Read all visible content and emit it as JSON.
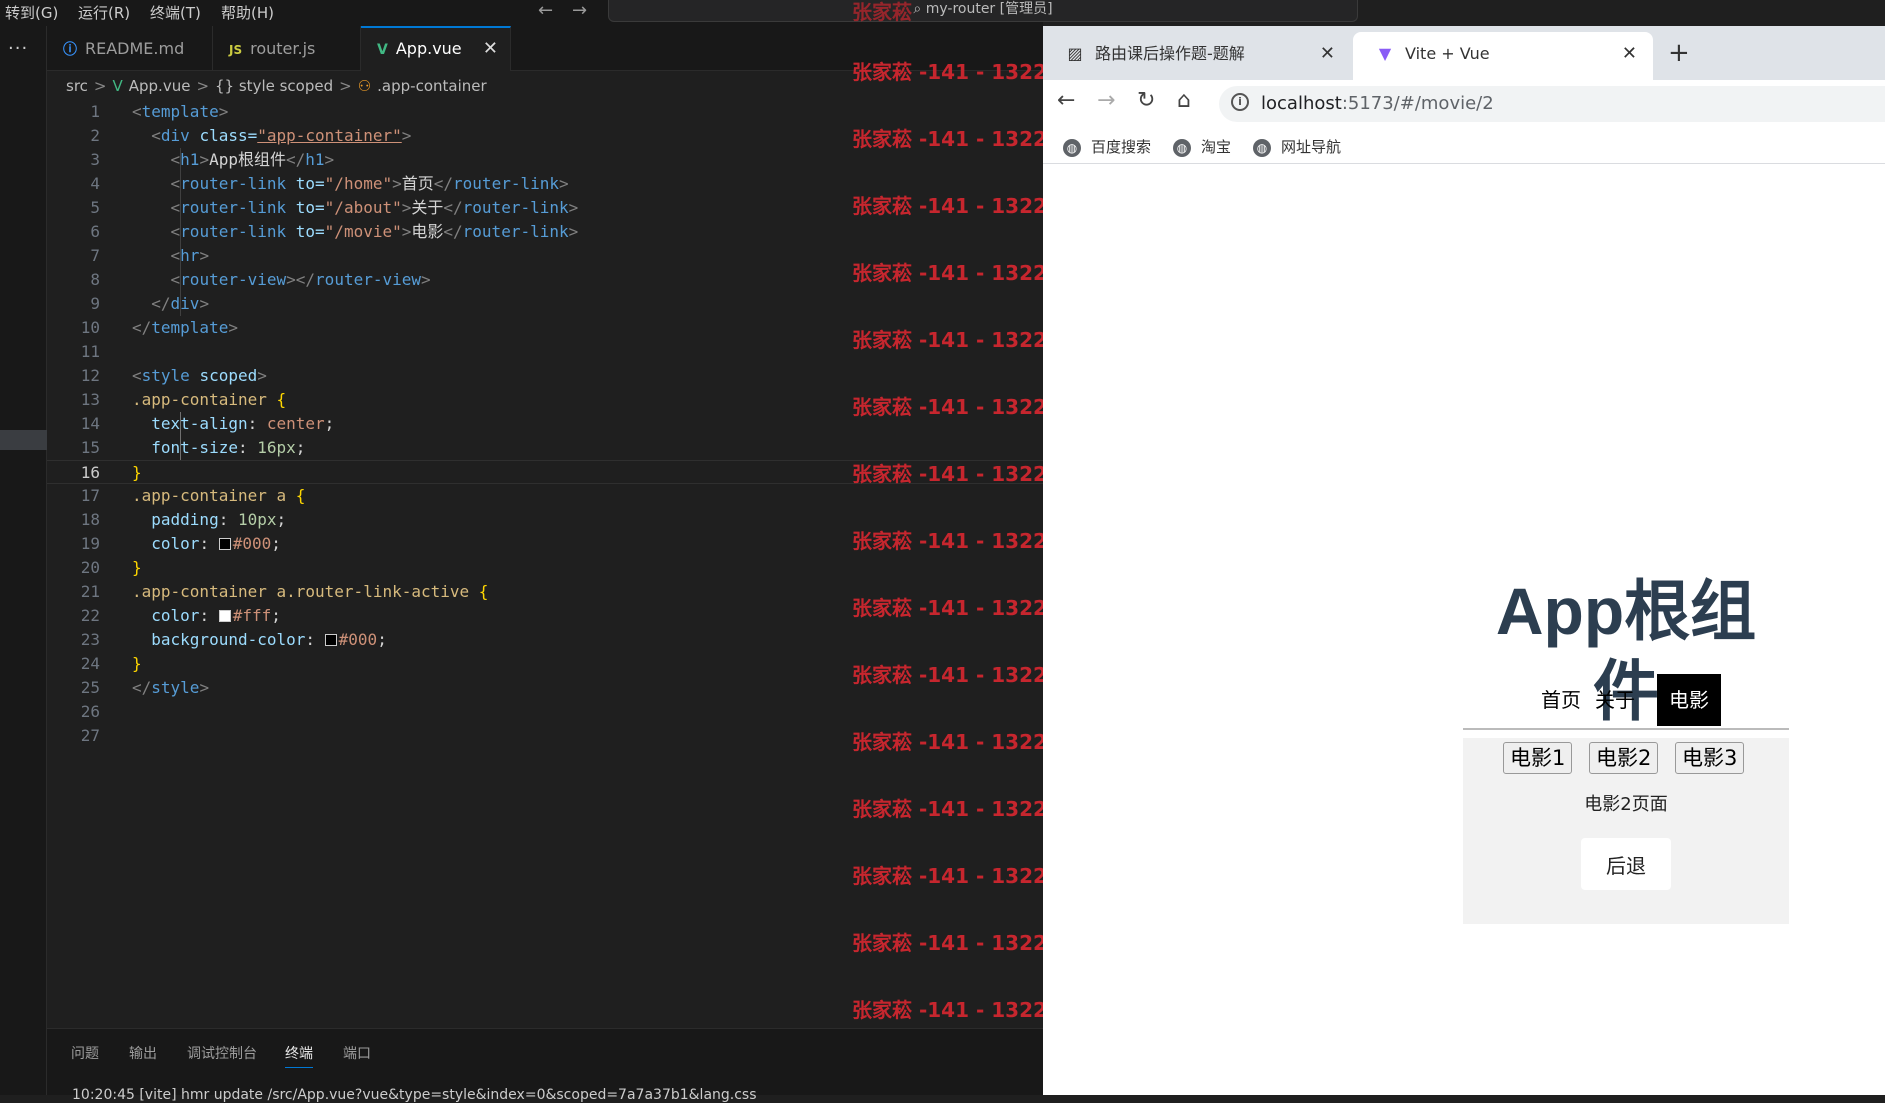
{
  "menubar": {
    "items": [
      "转到(G)",
      "运行(R)",
      "终端(T)",
      "帮助(H)"
    ],
    "command_center": "my-router [管理员]"
  },
  "editor_tabs": [
    {
      "icon": "ⓘ",
      "label": "README.md"
    },
    {
      "icon": "JS",
      "label": "router.js"
    },
    {
      "icon": "V",
      "label": "App.vue",
      "close": "✕"
    }
  ],
  "breadcrumb": [
    "src",
    ">",
    "App.vue",
    ">",
    "{} style scoped",
    ">",
    ".app-container"
  ],
  "code_lines": [
    {
      "n": "1"
    },
    {
      "n": "2"
    },
    {
      "n": "3"
    },
    {
      "n": "4"
    },
    {
      "n": "5"
    },
    {
      "n": "6"
    },
    {
      "n": "7"
    },
    {
      "n": "8"
    },
    {
      "n": "9"
    },
    {
      "n": "10"
    },
    {
      "n": "11"
    },
    {
      "n": "12"
    },
    {
      "n": "13"
    },
    {
      "n": "14"
    },
    {
      "n": "15"
    },
    {
      "n": "16"
    },
    {
      "n": "17"
    },
    {
      "n": "18"
    },
    {
      "n": "19"
    },
    {
      "n": "20"
    },
    {
      "n": "21"
    },
    {
      "n": "22"
    },
    {
      "n": "23"
    },
    {
      "n": "24"
    },
    {
      "n": "25"
    },
    {
      "n": "26"
    },
    {
      "n": "27"
    }
  ],
  "code": {
    "l1": [
      "<",
      "template",
      ">"
    ],
    "l2": [
      "<",
      "div",
      " class=",
      "\"app-container\"",
      ">"
    ],
    "l3": [
      "<",
      "h1",
      ">",
      "App根组件",
      "</",
      "h1",
      ">"
    ],
    "l4": [
      "<",
      "router-link",
      " to=",
      "\"/home\"",
      ">",
      "首页",
      "</",
      "router-link",
      ">"
    ],
    "l5": [
      "<",
      "router-link",
      " to=",
      "\"/about\"",
      ">",
      "关于",
      "</",
      "router-link",
      ">"
    ],
    "l6": [
      "<",
      "router-link",
      " to=",
      "\"/movie\"",
      ">",
      "电影",
      "</",
      "router-link",
      ">"
    ],
    "l7": [
      "<",
      "hr",
      ">"
    ],
    "l8": [
      "<",
      "router-view",
      "></",
      "router-view",
      ">"
    ],
    "l9": [
      "</",
      "div",
      ">"
    ],
    "l10": [
      "</",
      "template",
      ">"
    ],
    "l12": [
      "<",
      "style",
      " scoped",
      ">"
    ],
    "l13": [
      ".app-container",
      " {"
    ],
    "l14": [
      "text-align",
      ": ",
      "center",
      ";"
    ],
    "l15": [
      "font-size",
      ": ",
      "16px",
      ";"
    ],
    "l16": [
      "}"
    ],
    "l17": [
      ".app-container a",
      " {"
    ],
    "l18": [
      "padding",
      ": ",
      "10px",
      ";"
    ],
    "l19": [
      "color",
      ": ",
      "#000",
      ";"
    ],
    "l20": [
      "}"
    ],
    "l21": [
      ".app-container a.router-link-active",
      " {"
    ],
    "l22": [
      "color",
      ": ",
      "#fff",
      ";"
    ],
    "l23": [
      "background-color",
      ": ",
      "#000",
      ";"
    ],
    "l24": [
      "}"
    ],
    "l25": [
      "</",
      "style",
      ">"
    ]
  },
  "watermark": "张家菘 -141 - 1322",
  "watermark_top": "张家菘",
  "panel": {
    "tabs": [
      "问题",
      "输出",
      "调试控制台",
      "终端",
      "端口"
    ],
    "terminal_line": "10:20:45 [vite] hmr update /src/App.vue?vue&type=style&index=0&scoped=7a7a37b1&lang.css"
  },
  "browser": {
    "tabs": [
      {
        "label": "路由课后操作题-题解",
        "close": "✕"
      },
      {
        "label": "Vite + Vue",
        "close": "✕"
      }
    ],
    "new_tab": "+",
    "url_host": "localhost",
    "url_path": ":5173/#/movie/2",
    "bookmarks": [
      "百度搜索",
      "淘宝",
      "网址导航"
    ]
  },
  "app": {
    "title": "App根组件",
    "links": [
      "首页",
      "关于",
      "电影"
    ],
    "active_link": 2,
    "movie_buttons": [
      "电影1",
      "电影2",
      "电影3"
    ],
    "movie_text": "电影2页面",
    "back_button": "后退"
  }
}
